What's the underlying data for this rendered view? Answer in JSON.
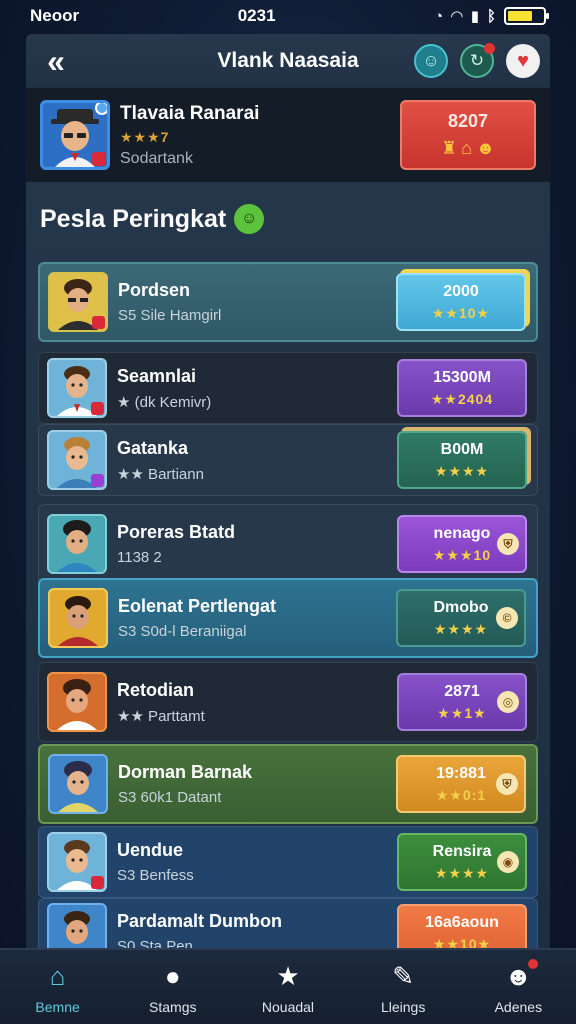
{
  "status_bar": {
    "carrier": "Neoor",
    "time": "0231"
  },
  "header": {
    "title": "Vlank Naasaia"
  },
  "profile": {
    "name": "Tlavaia Ranarai",
    "stars": "★★★7",
    "subtitle": "Sodartank",
    "score": "8207"
  },
  "leaderboard": {
    "title": "Pesla Peringkat",
    "rows": [
      {
        "name": "Pordsen",
        "subtitle": "S5 Sile Hamgirl",
        "value": "2000",
        "stars": "★★10★"
      },
      {
        "name": "Seamnlai",
        "subtitle": "★ (dk Kemivr)",
        "value": "15300M",
        "stars": "★★2404"
      },
      {
        "name": "Gatanka",
        "subtitle": "★★ Bartiann",
        "value": "B00M",
        "stars": "★★★★"
      },
      {
        "name": "Poreras Btatd",
        "subtitle": "1138 2",
        "value": "nenago",
        "stars": "★★★10"
      },
      {
        "name": "Eolenat Pertlengat",
        "subtitle": "S3 S0d-l Beraniigal",
        "value": "Dmobo",
        "stars": "★★★★"
      },
      {
        "name": "Retodian",
        "subtitle": "★★ Parttamt",
        "value": "2871",
        "stars": "★★1★"
      },
      {
        "name": "Dorman Barnak",
        "subtitle": "S3 60k1 Datant",
        "value": "19:881",
        "stars": "★★0:1"
      },
      {
        "name": "Uendue",
        "subtitle": "S3 Benfess",
        "value": "Rensira",
        "stars": "★★★★"
      },
      {
        "name": "Pardamalt Dumbon",
        "subtitle": "S0 Sta Pen",
        "value": "16a6aoun",
        "stars": "★★10★"
      }
    ]
  },
  "nav": {
    "items": [
      {
        "label": "Bemne"
      },
      {
        "label": "Stamgs"
      },
      {
        "label": "Nouadal"
      },
      {
        "label": "Lleings"
      },
      {
        "label": "Adenes"
      }
    ]
  },
  "colors": {
    "accent": "#5fc8e0",
    "background": "#0f1b33",
    "profile_score_box": "#d9423a"
  }
}
